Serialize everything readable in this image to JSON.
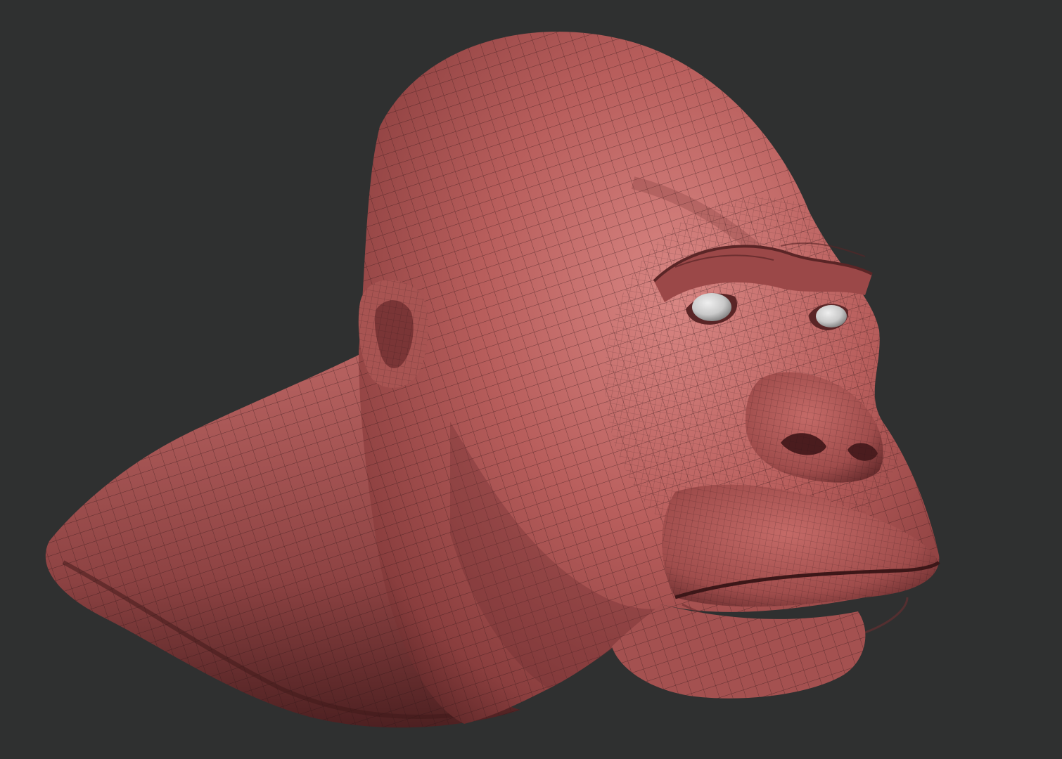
{
  "scene": {
    "subject": "sculpted-gorilla-head-bust",
    "background_color": "#2f3030",
    "material_color": "#b85e5c",
    "material_shadow_color": "#6e2f30",
    "material_highlight_color": "#d98784",
    "eye_color": "#c9c9c9",
    "wireframe_color": "#2a1416",
    "wireframe_visible": true
  }
}
